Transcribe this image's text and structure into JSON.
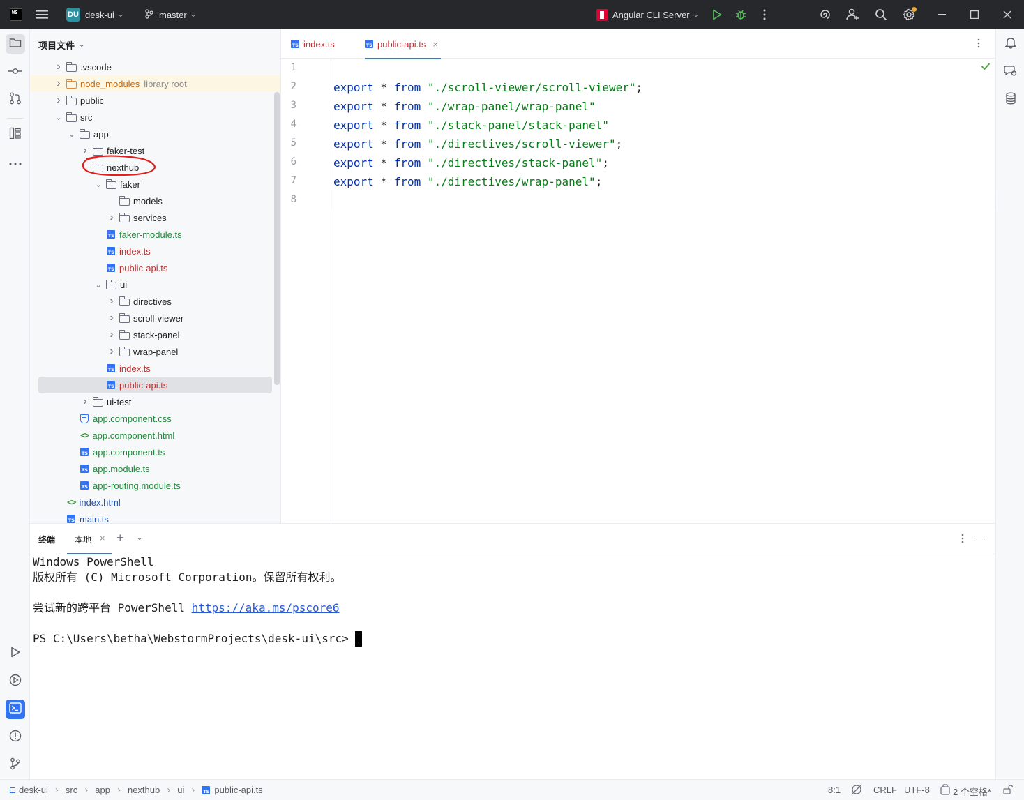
{
  "titlebar": {
    "app_logo": "WS",
    "project_badge": "DU",
    "project_name": "desk-ui",
    "branch": "master",
    "run_config": "Angular CLI Server"
  },
  "project_panel": {
    "title": "项目文件",
    "tree": [
      {
        "label": "vscode",
        "prefix": ".",
        "type": "folder",
        "depth": 1,
        "arrow": "collapsed"
      },
      {
        "label": "node_modules",
        "note": "library root",
        "type": "folder-orange",
        "depth": 1,
        "arrow": "collapsed"
      },
      {
        "label": "public",
        "type": "folder",
        "depth": 1,
        "arrow": "collapsed"
      },
      {
        "label": "src",
        "type": "folder",
        "depth": 1,
        "arrow": "expanded"
      },
      {
        "label": "app",
        "type": "folder",
        "depth": 2,
        "arrow": "expanded"
      },
      {
        "label": "faker-test",
        "type": "folder",
        "depth": 3,
        "arrow": "collapsed"
      },
      {
        "label": "nexthub",
        "type": "folder",
        "depth": 3,
        "arrow": "expanded"
      },
      {
        "label": "faker",
        "type": "folder",
        "depth": 4,
        "arrow": "expanded"
      },
      {
        "label": "models",
        "type": "folder",
        "depth": 5,
        "arrow": "none"
      },
      {
        "label": "services",
        "type": "folder",
        "depth": 5,
        "arrow": "collapsed"
      },
      {
        "label": "faker-module.ts",
        "type": "ts",
        "depth": 5,
        "color": "green"
      },
      {
        "label": "index.ts",
        "type": "ts",
        "depth": 5,
        "color": "red"
      },
      {
        "label": "public-api.ts",
        "type": "ts",
        "depth": 5,
        "color": "red"
      },
      {
        "label": "ui",
        "type": "folder",
        "depth": 4,
        "arrow": "expanded"
      },
      {
        "label": "directives",
        "type": "folder",
        "depth": 5,
        "arrow": "collapsed"
      },
      {
        "label": "scroll-viewer",
        "type": "folder",
        "depth": 5,
        "arrow": "collapsed"
      },
      {
        "label": "stack-panel",
        "type": "folder",
        "depth": 5,
        "arrow": "collapsed"
      },
      {
        "label": "wrap-panel",
        "type": "folder",
        "depth": 5,
        "arrow": "collapsed"
      },
      {
        "label": "index.ts",
        "type": "ts",
        "depth": 5,
        "color": "red"
      },
      {
        "label": "public-api.ts",
        "type": "ts",
        "depth": 5,
        "color": "red",
        "selected": true
      },
      {
        "label": "ui-test",
        "type": "folder",
        "depth": 3,
        "arrow": "collapsed"
      },
      {
        "label": "app.component.css",
        "type": "css",
        "depth": 3,
        "color": "green"
      },
      {
        "label": "app.component.html",
        "type": "html",
        "depth": 3,
        "color": "green"
      },
      {
        "label": "app.component.ts",
        "type": "ts",
        "depth": 3,
        "color": "green"
      },
      {
        "label": "app.module.ts",
        "type": "ts",
        "depth": 3,
        "color": "green"
      },
      {
        "label": "app-routing.module.ts",
        "type": "ts",
        "depth": 3,
        "color": "green"
      },
      {
        "label": "index.html",
        "type": "html",
        "depth": 2,
        "color": "blue"
      },
      {
        "label": "main.ts",
        "type": "ts",
        "depth": 2,
        "color": "blue"
      }
    ]
  },
  "editor": {
    "tabs": [
      {
        "label": "index.ts",
        "active": false
      },
      {
        "label": "public-api.ts",
        "active": true
      }
    ],
    "line_numbers": [
      "1",
      "2",
      "3",
      "4",
      "5",
      "6",
      "7",
      "8"
    ],
    "lines": [
      {
        "kw": "",
        "op": "",
        "from": "",
        "str": "",
        "end": ""
      },
      {
        "kw": "export",
        "op": " * ",
        "from": "from",
        "str": " \"./scroll-viewer/scroll-viewer\"",
        "end": ";"
      },
      {
        "kw": "export",
        "op": " * ",
        "from": "from",
        "str": " \"./wrap-panel/wrap-panel\"",
        "end": ""
      },
      {
        "kw": "export",
        "op": " * ",
        "from": "from",
        "str": " \"./stack-panel/stack-panel\"",
        "end": ""
      },
      {
        "kw": "export",
        "op": " * ",
        "from": "from",
        "str": " \"./directives/scroll-viewer\"",
        "end": ";"
      },
      {
        "kw": "export",
        "op": " * ",
        "from": "from",
        "str": " \"./directives/stack-panel\"",
        "end": ";"
      },
      {
        "kw": "export",
        "op": " * ",
        "from": "from",
        "str": " \"./directives/wrap-panel\"",
        "end": ";"
      },
      {
        "kw": "",
        "op": "",
        "from": "",
        "str": "",
        "end": ""
      }
    ]
  },
  "terminal": {
    "title": "终端",
    "tab": "本地",
    "line1": "Windows PowerShell",
    "line2": "版权所有 (C) Microsoft Corporation。保留所有权利。",
    "line3_prefix": "尝试新的跨平台 PowerShell ",
    "line3_link": "https://aka.ms/pscore6",
    "prompt": "PS C:\\Users\\betha\\WebstormProjects\\desk-ui\\src> "
  },
  "statusbar": {
    "breadcrumbs": [
      "desk-ui",
      "src",
      "app",
      "nexthub",
      "ui",
      "public-api.ts"
    ],
    "position": "8:1",
    "line_ending": "CRLF",
    "encoding": "UTF-8",
    "indent": "2 个空格*"
  },
  "colors": {
    "accent": "#3574f0",
    "keyword": "#0033b3",
    "string": "#067d17",
    "annotation": "#e0201e"
  }
}
